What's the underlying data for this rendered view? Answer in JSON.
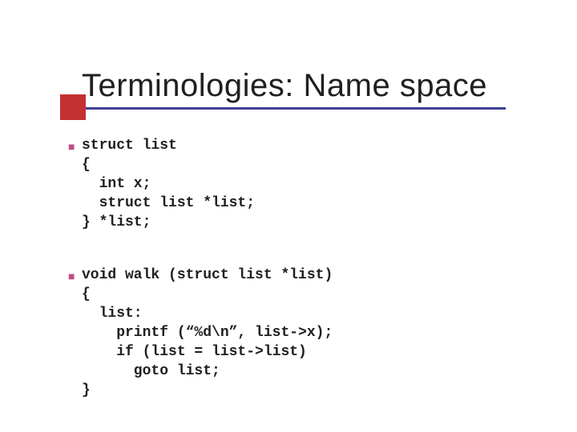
{
  "title": "Terminologies: Name space",
  "code_block_1": "struct list\n{\n  int x;\n  struct list *list;\n} *list;",
  "code_block_2": "void walk (struct list *list)\n{\n  list:\n    printf (“%d\\n”, list->x);\n    if (list = list->list)\n      goto list;\n}",
  "bullet_glyph": "■"
}
